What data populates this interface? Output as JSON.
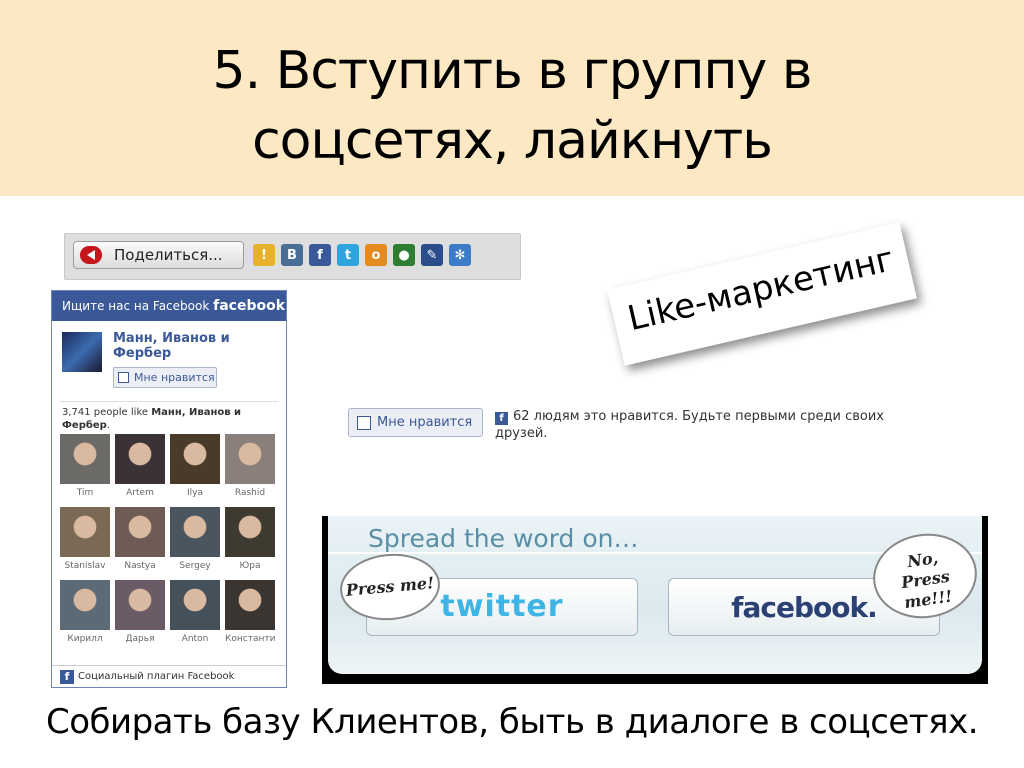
{
  "slide": {
    "title_line1": "5. Вступить в группу в",
    "title_line2": "соцсетях, лайкнуть",
    "bottom_text": "Собирать базу Клиентов, быть в диалоге в соцсетях."
  },
  "share_bar": {
    "button_label": "Поделиться...",
    "icons": [
      {
        "name": "moimir-icon",
        "glyph": "!",
        "color": "#e6b12b"
      },
      {
        "name": "vkontakte-icon",
        "glyph": "B",
        "color": "#4a6d96"
      },
      {
        "name": "facebook-icon",
        "glyph": "f",
        "color": "#3b5998"
      },
      {
        "name": "twitter-icon",
        "glyph": "t",
        "color": "#2fa4dd"
      },
      {
        "name": "odnoklassniki-icon",
        "glyph": "o",
        "color": "#e58a1f"
      },
      {
        "name": "livejournal-icon",
        "glyph": "●",
        "color": "#2e7d32"
      },
      {
        "name": "pencil-icon",
        "glyph": "✎",
        "color": "#2b4d8c"
      },
      {
        "name": "settings-icon",
        "glyph": "✻",
        "color": "#3d7cc7"
      }
    ]
  },
  "like_box": {
    "header_text": "Ищите нас на Facebook",
    "header_brand": "facebook",
    "page_name": "Манн, Иванов и Фербер",
    "like_button": "Мне нравится",
    "fans_prefix": "3,741 people like",
    "fans_page": "Манн, Иванов и Фербер",
    "fans_suffix": ".",
    "fans": [
      {
        "name": "Tim",
        "color": "#6b6a66"
      },
      {
        "name": "Artem",
        "color": "#3b3236"
      },
      {
        "name": "Ilya",
        "color": "#4a3a2a"
      },
      {
        "name": "Rashid",
        "color": "#8a7f7a"
      },
      {
        "name": "Stanislav",
        "color": "#7a6a55"
      },
      {
        "name": "Nastya",
        "color": "#6e5b55"
      },
      {
        "name": "Sergey",
        "color": "#4b5560"
      },
      {
        "name": "Юра",
        "color": "#3e3a2f"
      },
      {
        "name": "Кирилл",
        "color": "#5c6a76"
      },
      {
        "name": "Дарья",
        "color": "#6a5a66"
      },
      {
        "name": "Anton",
        "color": "#44505a"
      },
      {
        "name": "Константин",
        "color": "#3a3530"
      }
    ],
    "footer": "Социальный плагин Facebook"
  },
  "like_marketing": "Like-маркетинг",
  "like_row": {
    "button": "Мне нравится",
    "text": "62 людям это нравится. Будьте первыми среди своих друзей."
  },
  "spread": {
    "title": "Spread the word on…",
    "twitter_label": "twitter",
    "facebook_label": "facebook.",
    "bubble_left": "Press me!",
    "bubble_right_1": "No,",
    "bubble_right_2": "Press me!!!"
  }
}
